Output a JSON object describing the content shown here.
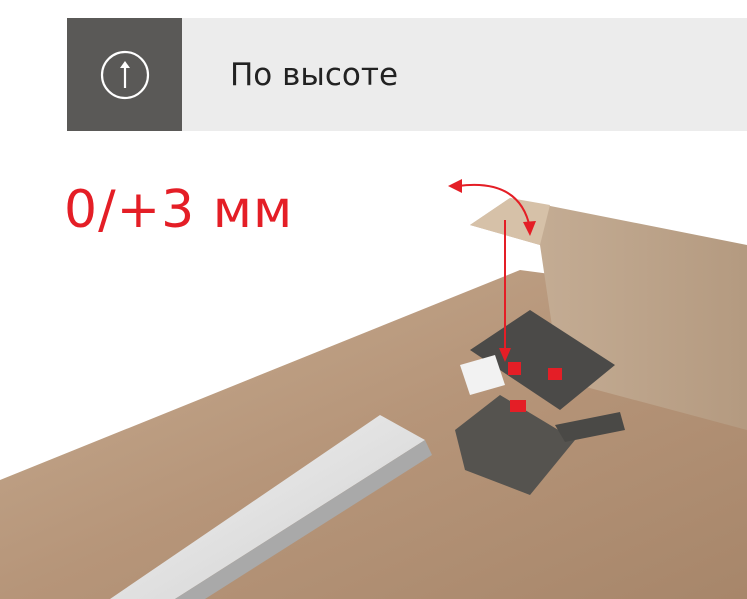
{
  "header": {
    "icon": "arrow-up-circle-icon",
    "label": "По высоте"
  },
  "adjustment": {
    "value_label": "0/+3 мм"
  },
  "colors": {
    "accent": "#e41e26",
    "icon_bg": "#5a5957",
    "label_bg": "#ececec"
  }
}
